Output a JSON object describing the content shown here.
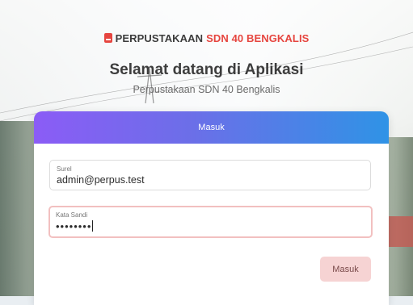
{
  "brand": {
    "icon": "book-icon",
    "part1": "PERPUSTAKAAN",
    "part2": "SDN 40 BENGKALIS",
    "accent_color": "#e6453f"
  },
  "welcome": {
    "title": "Selamat datang di Aplikasi",
    "subtitle": "Perpustakaan SDN 40 Bengkalis"
  },
  "login": {
    "header": "Masuk",
    "email": {
      "label": "Surel",
      "value": "admin@perpus.test"
    },
    "password": {
      "label": "Kata Sandi",
      "value": "••••••••"
    },
    "submit_label": "Masuk"
  }
}
